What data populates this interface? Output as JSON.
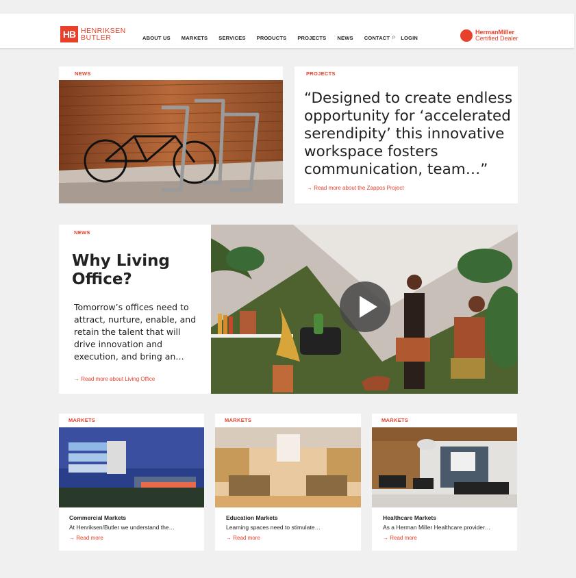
{
  "header": {
    "logo_mark": "HB",
    "logo_line1": "HENRIKSEN",
    "logo_line2": "BUTLER",
    "nav": [
      "ABOUT US",
      "MARKETS",
      "SERVICES",
      "PRODUCTS",
      "PROJECTS",
      "NEWS",
      "CONTACT",
      "LOGIN"
    ],
    "search_icon": "⌕",
    "dealer_line1": "HermanMiller",
    "dealer_line2": "Certified Dealer"
  },
  "news_card": {
    "tag": "NEWS"
  },
  "projects_card": {
    "tag": "PROJECTS",
    "quote": "“Designed to create endless opportunity for ‘accelerated serendipity’ this innovative workspace fosters communication, team…”",
    "link": "→ Read more about the Zappos Project"
  },
  "living_office": {
    "tag": "NEWS",
    "title": "Why Living Office?",
    "body": "Tomorrow’s offices need to attract, nurture, enable, and retain the talent that will drive innovation and execution, and bring an…",
    "link": "→  Read more about Living Office",
    "play_icon": "▶"
  },
  "markets": [
    {
      "tag": "MARKETS",
      "title": "Commercial Markets",
      "desc": "At Henriksen/Butler we understand the…",
      "link": "→  Read more"
    },
    {
      "tag": "MARKETS",
      "title": "Education Markets",
      "desc": "Learning spaces need to stimulate…",
      "link": "→  Read more"
    },
    {
      "tag": "MARKETS",
      "title": "Healthcare Markets",
      "desc": "As a Herman Miller Healthcare provider…",
      "link": "→  Read more"
    }
  ],
  "colors": {
    "accent": "#e8402a",
    "background": "#f0f0f0"
  }
}
